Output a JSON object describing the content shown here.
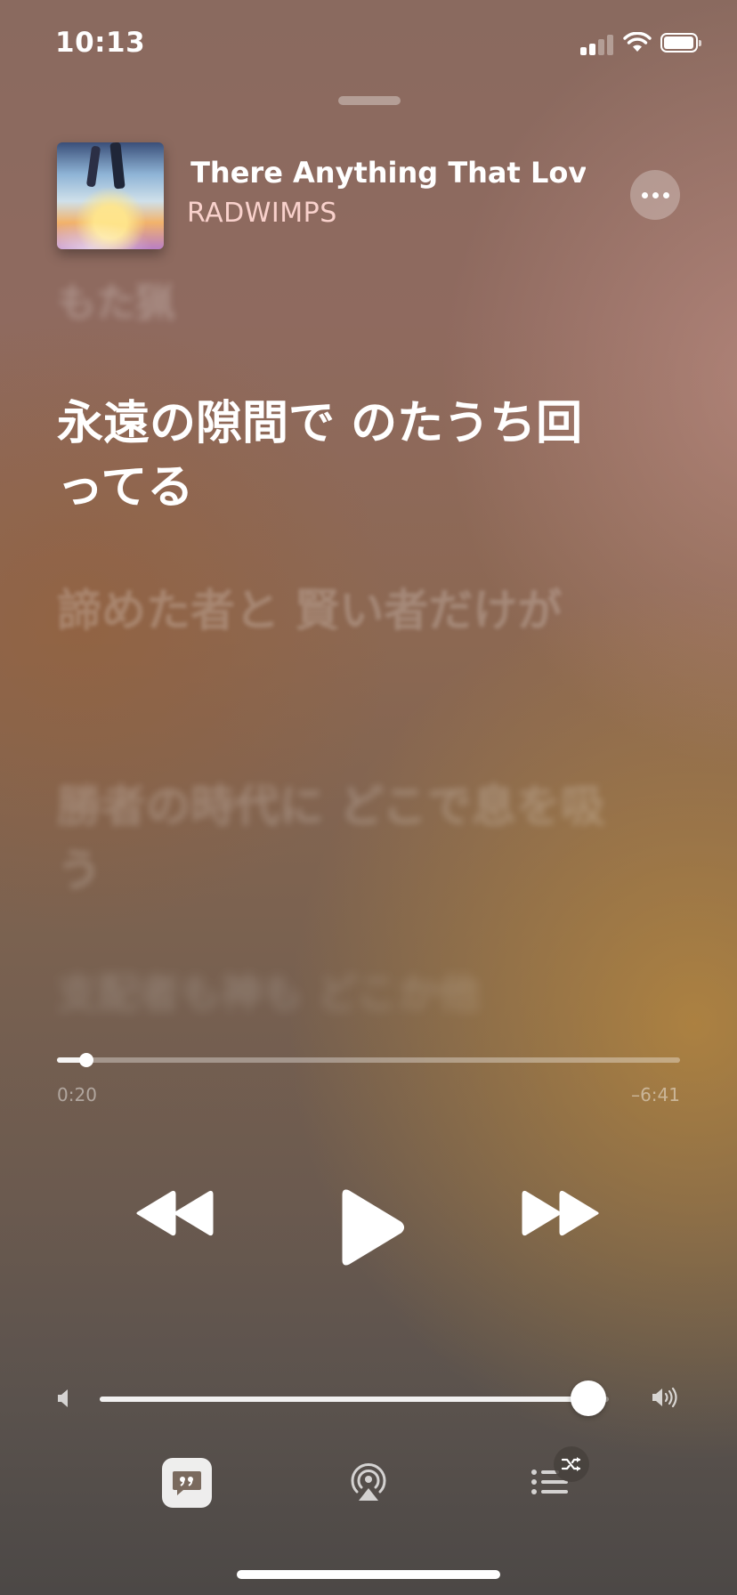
{
  "status_bar": {
    "time": "10:13"
  },
  "now_playing": {
    "title": "Is There Anything That Love Can Do?",
    "artist": "RADWIMPS"
  },
  "lyrics": {
    "prev_line": "もた猟",
    "current_line": "永遠の隙間で のたうち回ってる",
    "next_lines": [
      "諦めた者と 賢い者だけが",
      "勝者の時代に どこで息を吸う",
      "支配者も神も どこか他"
    ]
  },
  "playback": {
    "elapsed": "0:20",
    "remaining": "–6:41",
    "progress": 0.047,
    "state": "paused"
  },
  "volume": {
    "level": 0.96
  },
  "icons": {
    "more": "ellipsis-icon",
    "rewind": "rewind-icon",
    "play": "play-icon",
    "fast_forward": "fast-forward-icon",
    "volume_low": "speaker-low-icon",
    "volume_high": "speaker-high-icon",
    "lyrics": "lyrics-quote-icon",
    "airplay": "airplay-icon",
    "queue": "queue-list-icon",
    "shuffle": "shuffle-icon"
  },
  "colors": {
    "accent_artist": "#ffd7d2",
    "background_top": "#8a6a5f",
    "background_bottom": "#4c4846"
  }
}
